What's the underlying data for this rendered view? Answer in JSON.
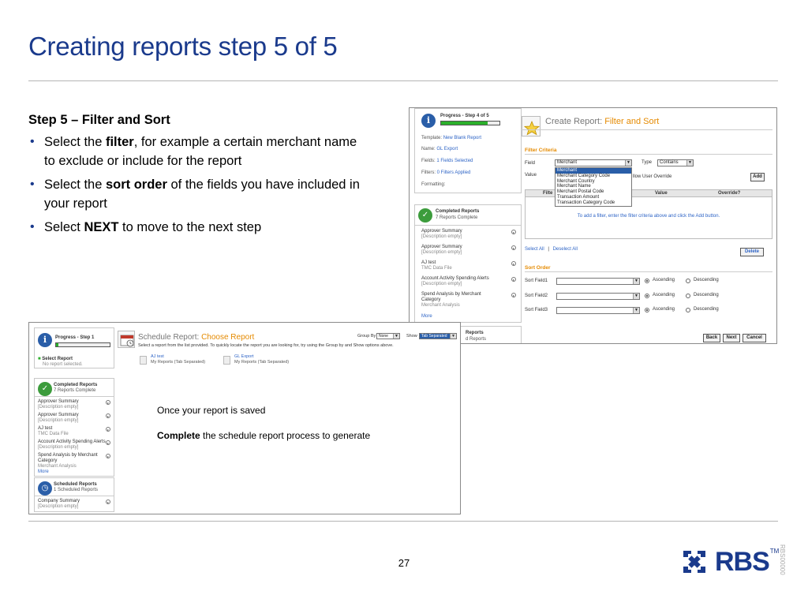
{
  "slide": {
    "title": "Creating reports step 5 of 5",
    "page_number": "27",
    "side_code": "RBS00000",
    "logo_word": "RBS",
    "logo_tm": "TM"
  },
  "steps": {
    "heading": "Step 5 – Filter and Sort",
    "b1_pre": "Select the ",
    "b1_bold": "filter",
    "b1_post": ", for example a certain merchant name to exclude or include for the report",
    "b2_pre": "Select the ",
    "b2_bold": "sort order",
    "b2_post": " of the fields you have included in your report",
    "b3_pre": "Select ",
    "b3_bold": "NEXT",
    "b3_post": " to move to the next step"
  },
  "shot1": {
    "progress_title": "Progress - Step 4 of 5",
    "progress_fraction": 0.8,
    "template_label": "Template:",
    "template_value": "New Blank Report",
    "name_label": "Name:",
    "name_value": "GL Export",
    "fields_label": "Fields:",
    "fields_value": "1 Fields Selected",
    "filters_label": "Filters:",
    "filters_value": "0 Filters Applied",
    "formatting_label": "Formatting:",
    "completed_title": "Completed Reports",
    "completed_sub": "7 Reports Complete",
    "reports": [
      {
        "name": "Approver Summary",
        "desc": "[Description empty]"
      },
      {
        "name": "Approver Summary",
        "desc": "[Description empty]"
      },
      {
        "name": "AJ test",
        "desc": "TMC Data File"
      },
      {
        "name": "Account Activity Spending Alerts",
        "desc": "[Description empty]"
      },
      {
        "name": "Spend Analysis by Merchant",
        "name2": "Category",
        "desc": "Merchant Analysis"
      }
    ],
    "more": "More",
    "scheduled_title_partial": "Reports",
    "scheduled_sub_partial": "d Reports",
    "title_prefix": "Create Report: ",
    "title_accent": "Filter and Sort",
    "filter_criteria": "Filter Criteria",
    "field_label": "Field",
    "field_value": "Merchant",
    "type_label": "Type",
    "type_value": "Contains",
    "value_label": "Value",
    "allow_override": "llow User Override",
    "add_button": "Add",
    "dropdown_options": [
      "Merchant",
      "Merchant Category Code",
      "Merchant Country",
      "Merchant Name",
      "Merchant Postal Code",
      "Transaction Amount",
      "Transaction Category Code"
    ],
    "col_filter": "Filte",
    "col_value": "Value",
    "col_override": "Override?",
    "empty_msg": "To add a filter, enter the filter criteria above and click the Add button.",
    "select_all": "Select All",
    "sep": "|",
    "deselect_all": "Deselect All",
    "delete_button": "Delete",
    "sort_order": "Sort Order",
    "sort_fields": [
      "Sort Field1",
      "Sort Field2",
      "Sort Field3"
    ],
    "ascending": "Ascending",
    "descending": "Descending",
    "back": "Back",
    "next": "Next",
    "cancel": "Cancel"
  },
  "shot2": {
    "progress_title": "Progress - Step 1",
    "progress_fraction": 0.05,
    "select_report": "Select Report",
    "no_report": "No report selected.",
    "completed_title": "Completed Reports",
    "completed_sub": "7 Reports Complete",
    "reports": [
      {
        "name": "Approver Summary",
        "desc": "[Description empty]"
      },
      {
        "name": "Approver Summary",
        "desc": "[Description empty]"
      },
      {
        "name": "AJ test",
        "desc": "TMC Data File"
      },
      {
        "name": "Account Activity Spending Alerts",
        "desc": "[Description empty]"
      },
      {
        "name": "Spend Analysis by Merchant",
        "name2": "Category",
        "desc": "Merchant Analysis"
      }
    ],
    "more": "More",
    "scheduled_title": "Scheduled Reports",
    "scheduled_sub": "1 Scheduled Reports",
    "company_summary": "Company Summary",
    "company_desc": "[Description empty]",
    "title_prefix": "Schedule Report: ",
    "title_accent": "Choose Report",
    "group_by_label": "Group By",
    "group_by_value": "None",
    "show_label": "Show",
    "show_value": "Tab Separated",
    "subtitle": "Select a report from the list provided. To quickly locate the report you are looking for, try using the Group by and Show options above.",
    "files": [
      {
        "title": "AJ test",
        "sub": "My Reports (Tab Separated)"
      },
      {
        "title": "GL Export",
        "sub": "My Reports (Tab Separated)"
      }
    ],
    "note1": "Once your report is saved",
    "note2_bold": "Complete",
    "note2_rest": " the schedule report process to generate"
  }
}
